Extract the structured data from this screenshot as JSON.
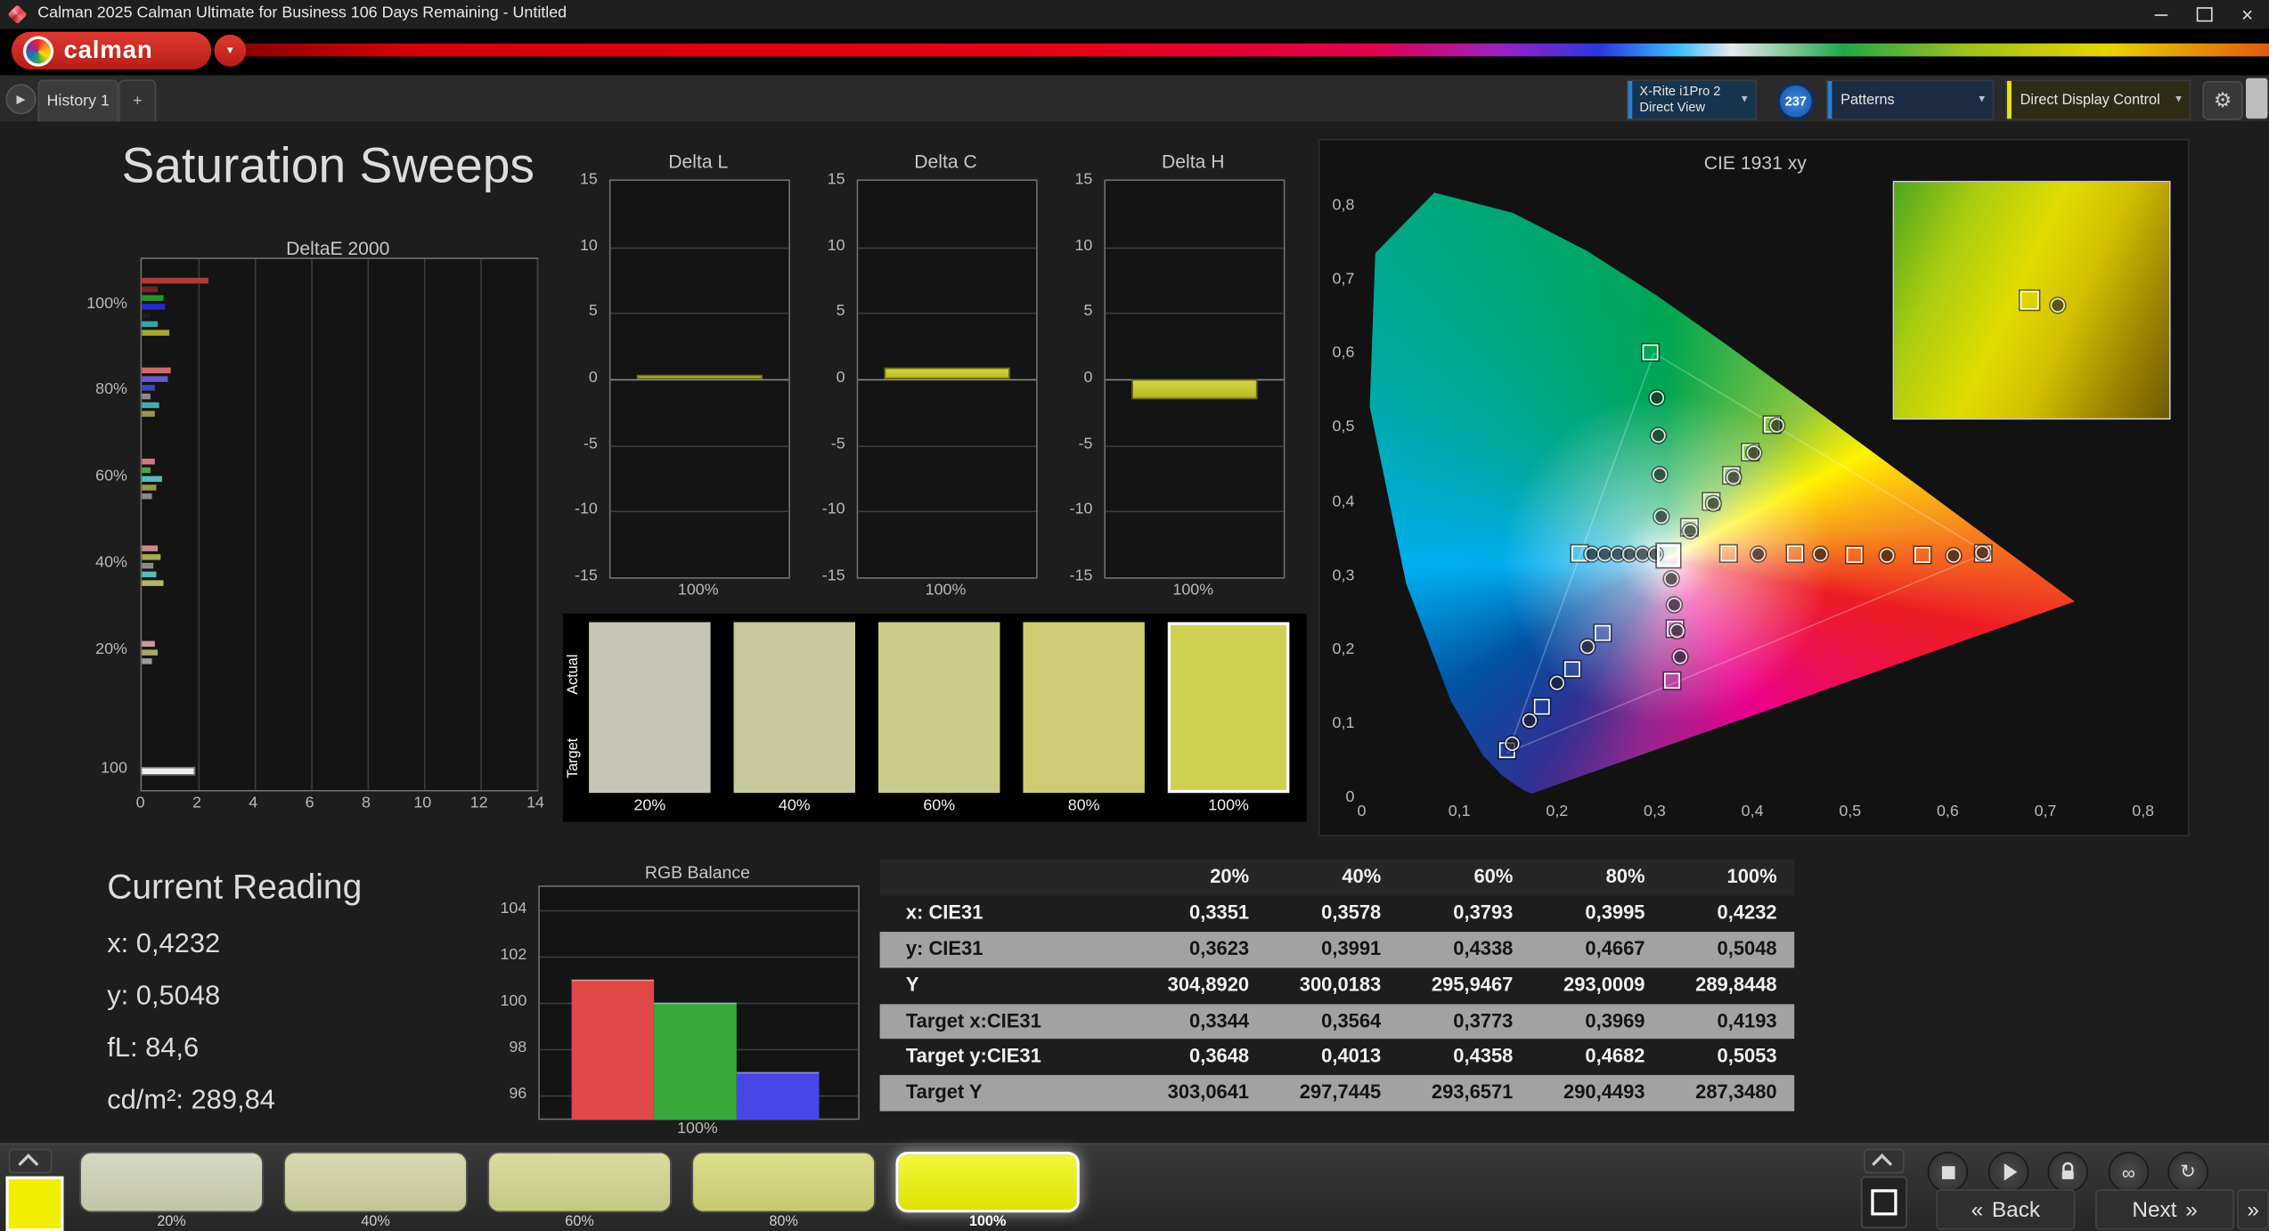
{
  "window": {
    "title": "Calman 2025 Calman Ultimate for Business 106 Days Remaining  - Untitled"
  },
  "icons": {
    "close": "×",
    "minimize": "–",
    "dropdown": "▼",
    "gear": "⚙",
    "play": "▶",
    "infinity": "∞",
    "refresh": "↻",
    "add_tab": "+",
    "back_chevron": "«",
    "next_chevron": "»",
    "expand_right": "»"
  },
  "header": {
    "logo_text": "calman",
    "meter": {
      "line1": "X-Rite i1Pro 2",
      "line2": "Direct View",
      "badge": "237"
    },
    "patterns_label": "Patterns",
    "display_control_label": "Direct Display Control"
  },
  "tabs": {
    "history": "History 1"
  },
  "page_title": "Saturation Sweeps",
  "current_reading": {
    "heading": "Current Reading",
    "lines": [
      "x: 0,4232",
      "y: 0,5048",
      "fL: 84,6",
      "cd/m²: 289,84"
    ]
  },
  "swatch_panel": {
    "actual_label": "Actual",
    "target_label": "Target",
    "items": [
      {
        "label": "20%",
        "color": "#c6c6b2",
        "selected": false
      },
      {
        "label": "40%",
        "color": "#c8c89e",
        "selected": false
      },
      {
        "label": "60%",
        "color": "#caca8a",
        "selected": false
      },
      {
        "label": "80%",
        "color": "#cccc74",
        "selected": false
      },
      {
        "label": "100%",
        "color": "#cfcf52",
        "selected": true
      }
    ]
  },
  "table": {
    "columns": [
      "",
      "20%",
      "40%",
      "60%",
      "80%",
      "100%"
    ],
    "rows": [
      {
        "label": "x: CIE31",
        "values": [
          "0,3351",
          "0,3578",
          "0,3793",
          "0,3995",
          "0,4232"
        ]
      },
      {
        "label": "y: CIE31",
        "values": [
          "0,3623",
          "0,3991",
          "0,4338",
          "0,4667",
          "0,5048"
        ]
      },
      {
        "label": "Y",
        "values": [
          "304,8920",
          "300,0183",
          "295,9467",
          "293,0009",
          "289,8448"
        ]
      },
      {
        "label": "Target x:CIE31",
        "values": [
          "0,3344",
          "0,3564",
          "0,3773",
          "0,3969",
          "0,4193"
        ]
      },
      {
        "label": "Target y:CIE31",
        "values": [
          "0,3648",
          "0,4013",
          "0,4358",
          "0,4682",
          "0,5053"
        ]
      },
      {
        "label": "Target Y",
        "values": [
          "303,0641",
          "297,7445",
          "293,6571",
          "290,4493",
          "287,3480"
        ]
      }
    ]
  },
  "bottom_bar": {
    "current_patch_color": "#f2ee00",
    "patches": [
      {
        "label": "20%",
        "color_top": "#d6d9c2",
        "color_bottom": "#c2c5a8",
        "selected": false
      },
      {
        "label": "40%",
        "color_top": "#d8dab0",
        "color_bottom": "#c4c696",
        "selected": false
      },
      {
        "label": "60%",
        "color_top": "#dadc9e",
        "color_bottom": "#c6c884",
        "selected": false
      },
      {
        "label": "80%",
        "color_top": "#dcde8a",
        "color_bottom": "#c8ca70",
        "selected": false
      },
      {
        "label": "100%",
        "color_top": "#f2f83a",
        "color_bottom": "#dde200",
        "selected": true
      }
    ],
    "back_label": "Back",
    "next_label": "Next"
  },
  "chart_data": [
    {
      "id": "deltae2000",
      "type": "bar",
      "orientation": "horizontal",
      "title": "DeltaE 2000",
      "xlim": [
        0,
        14
      ],
      "xticks": [
        "0",
        "2",
        "4",
        "6",
        "8",
        "10",
        "12",
        "14"
      ],
      "row_labels": [
        "100%",
        "80%",
        "60%",
        "40%",
        "20%",
        "100"
      ],
      "groups": [
        {
          "label": "100%",
          "bars": [
            {
              "color": "#b23a3a",
              "value": 2.35
            },
            {
              "color": "#7e1f1f",
              "value": 0.55
            },
            {
              "color": "#2f8f2f",
              "value": 0.75
            },
            {
              "color": "#2a2ac8",
              "value": 0.8
            },
            {
              "color": "#1d1d1d",
              "value": 0.3
            },
            {
              "color": "#2fa8a8",
              "value": 0.55
            },
            {
              "color": "#a8a82f",
              "value": 0.95
            }
          ]
        },
        {
          "label": "80%",
          "bars": [
            {
              "color": "#d06a6a",
              "value": 1.05
            },
            {
              "color": "#6a5ad0",
              "value": 0.9
            },
            {
              "color": "#3a4ac0",
              "value": 0.45
            },
            {
              "color": "#8a8a8a",
              "value": 0.3
            },
            {
              "color": "#3fb0b0",
              "value": 0.6
            },
            {
              "color": "#9a9a45",
              "value": 0.45
            }
          ]
        },
        {
          "label": "60%",
          "bars": [
            {
              "color": "#cc7a7a",
              "value": 0.45
            },
            {
              "color": "#45a845",
              "value": 0.3
            },
            {
              "color": "#55bcbc",
              "value": 0.7
            },
            {
              "color": "#9a9a45",
              "value": 0.5
            },
            {
              "color": "#8a8a8a",
              "value": 0.35
            }
          ]
        },
        {
          "label": "40%",
          "bars": [
            {
              "color": "#cc8a8a",
              "value": 0.55
            },
            {
              "color": "#a8a855",
              "value": 0.65
            },
            {
              "color": "#8a8a8a",
              "value": 0.4
            },
            {
              "color": "#55bcbc",
              "value": 0.5
            },
            {
              "color": "#b4b46a",
              "value": 0.75
            }
          ]
        },
        {
          "label": "20%",
          "bars": [
            {
              "color": "#cc9a9a",
              "value": 0.45
            },
            {
              "color": "#a8a86a",
              "value": 0.55
            },
            {
              "color": "#9a9a9a",
              "value": 0.35
            }
          ]
        },
        {
          "label": "100",
          "bars": [
            {
              "color": "#efefef",
              "value": 1.85,
              "border": true
            }
          ]
        }
      ]
    },
    {
      "id": "delta_l",
      "type": "bar",
      "title": "Delta L",
      "ylim": [
        -15,
        15
      ],
      "yticks": [
        15,
        10,
        5,
        0,
        -5,
        -10,
        -15
      ],
      "categories": [
        "100%"
      ],
      "values": [
        0.3
      ],
      "bar_color": "#b8b81e",
      "xlabel": "100%"
    },
    {
      "id": "delta_c",
      "type": "bar",
      "title": "Delta C",
      "ylim": [
        -15,
        15
      ],
      "yticks": [
        15,
        10,
        5,
        0,
        -5,
        -10,
        -15
      ],
      "categories": [
        "100%"
      ],
      "values": [
        0.9
      ],
      "bar_color": "#b8b81e",
      "xlabel": "100%"
    },
    {
      "id": "delta_h",
      "type": "bar",
      "title": "Delta H",
      "ylim": [
        -15,
        15
      ],
      "yticks": [
        15,
        10,
        5,
        0,
        -5,
        -10,
        -15
      ],
      "categories": [
        "100%"
      ],
      "values": [
        -1.5
      ],
      "bar_color": "#b8b81e",
      "xlabel": "100%"
    },
    {
      "id": "rgb_balance",
      "type": "bar",
      "title": "RGB Balance",
      "ylim": [
        95,
        105
      ],
      "yticks": [
        104,
        102,
        100,
        98,
        96
      ],
      "categories": [
        "Red",
        "Green",
        "Blue"
      ],
      "values": [
        101,
        100,
        97
      ],
      "colors": [
        "#e04848",
        "#3aa83a",
        "#4747e8"
      ],
      "xlabel": "100%"
    },
    {
      "id": "cie1931",
      "type": "scatter",
      "title": "CIE 1931 xy",
      "xlim": [
        0,
        0.8
      ],
      "ylim": [
        0,
        0.85
      ],
      "xticks": [
        "0",
        "0,1",
        "0,2",
        "0,3",
        "0,4",
        "0,5",
        "0,6",
        "0,7",
        "0,8"
      ],
      "yticks": [
        "0",
        "0,1",
        "0,2",
        "0,3",
        "0,4",
        "0,5",
        "0,6",
        "0,7",
        "0,8"
      ],
      "white_point": {
        "x": 0.3127,
        "y": 0.329
      },
      "targets": [
        {
          "x": 0.222,
          "y": 0.331
        },
        {
          "x": 0.375,
          "y": 0.331
        },
        {
          "x": 0.443,
          "y": 0.33
        },
        {
          "x": 0.504,
          "y": 0.329
        },
        {
          "x": 0.573,
          "y": 0.328
        },
        {
          "x": 0.636,
          "y": 0.33
        },
        {
          "x": 0.295,
          "y": 0.602
        },
        {
          "x": 0.3344,
          "y": 0.3648
        },
        {
          "x": 0.3564,
          "y": 0.4013
        },
        {
          "x": 0.3773,
          "y": 0.4358
        },
        {
          "x": 0.3969,
          "y": 0.4682
        },
        {
          "x": 0.4193,
          "y": 0.5053
        },
        {
          "x": 0.317,
          "y": 0.158
        },
        {
          "x": 0.32,
          "y": 0.228
        },
        {
          "x": 0.246,
          "y": 0.223
        },
        {
          "x": 0.215,
          "y": 0.174
        },
        {
          "x": 0.184,
          "y": 0.123
        },
        {
          "x": 0.148,
          "y": 0.065
        }
      ],
      "measurements": [
        {
          "x": 0.234,
          "y": 0.331
        },
        {
          "x": 0.247,
          "y": 0.331
        },
        {
          "x": 0.26,
          "y": 0.331
        },
        {
          "x": 0.273,
          "y": 0.331
        },
        {
          "x": 0.286,
          "y": 0.331
        },
        {
          "x": 0.299,
          "y": 0.331
        },
        {
          "x": 0.405,
          "y": 0.331
        },
        {
          "x": 0.468,
          "y": 0.33
        },
        {
          "x": 0.536,
          "y": 0.329
        },
        {
          "x": 0.604,
          "y": 0.329
        },
        {
          "x": 0.634,
          "y": 0.332
        },
        {
          "x": 0.305,
          "y": 0.381
        },
        {
          "x": 0.304,
          "y": 0.438
        },
        {
          "x": 0.302,
          "y": 0.491
        },
        {
          "x": 0.301,
          "y": 0.542
        },
        {
          "x": 0.3351,
          "y": 0.3623
        },
        {
          "x": 0.3578,
          "y": 0.3991
        },
        {
          "x": 0.3793,
          "y": 0.4338
        },
        {
          "x": 0.3995,
          "y": 0.4667
        },
        {
          "x": 0.4232,
          "y": 0.5048
        },
        {
          "x": 0.316,
          "y": 0.297
        },
        {
          "x": 0.318,
          "y": 0.262
        },
        {
          "x": 0.321,
          "y": 0.227
        },
        {
          "x": 0.324,
          "y": 0.192
        },
        {
          "x": 0.23,
          "y": 0.205
        },
        {
          "x": 0.199,
          "y": 0.157
        },
        {
          "x": 0.17,
          "y": 0.105
        },
        {
          "x": 0.152,
          "y": 0.075
        }
      ]
    }
  ]
}
